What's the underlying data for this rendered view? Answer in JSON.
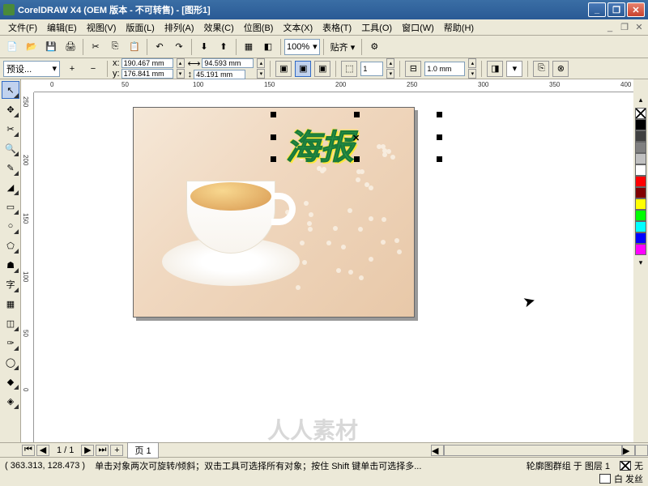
{
  "title": "CorelDRAW X4 (OEM 版本 - 不可转售) - [图形1]",
  "menu": {
    "file": "文件(F)",
    "edit": "编辑(E)",
    "view": "视图(V)",
    "layout": "版面(L)",
    "arrange": "排列(A)",
    "effects": "效果(C)",
    "bitmaps": "位图(B)",
    "text": "文本(X)",
    "table": "表格(T)",
    "tools": "工具(O)",
    "window": "窗口(W)",
    "help": "帮助(H)"
  },
  "zoom": "100%",
  "snap_label": "贴齐 ▾",
  "preset": "预设...",
  "coords": {
    "x_label": "x:",
    "y_label": "y:",
    "x": "190.467 mm",
    "y": "176.841 mm",
    "w_label": "⟷",
    "h_label": "↕",
    "w": "94.593 mm",
    "h": "45.191 mm"
  },
  "outline_width": "1.0 mm",
  "spinner": "1",
  "ruler_h": [
    "0",
    "50",
    "100",
    "150",
    "200",
    "250",
    "300",
    "350",
    "400"
  ],
  "ruler_v": [
    "250",
    "200",
    "150",
    "100",
    "50",
    "0"
  ],
  "art_text": "海报",
  "pagenav": {
    "pages": "1 / 1",
    "tab": "页 1"
  },
  "status": {
    "coords": "( 363.313, 128.473 )",
    "hint": "单击对象两次可旋转/倾斜；双击工具可选择所有对象；按住 Shift 键单击可选择多...",
    "selection": "轮廓图群组 于 图层 1",
    "fill_none": "无",
    "outline": "白 发丝"
  },
  "colors": [
    "#000000",
    "#404040",
    "#808080",
    "#c0c0c0",
    "#ffffff",
    "#ff0000",
    "#800000",
    "#ffff00",
    "#00ff00",
    "#00ffff",
    "#0000ff",
    "#ff00ff"
  ],
  "watermark": "人人素材"
}
